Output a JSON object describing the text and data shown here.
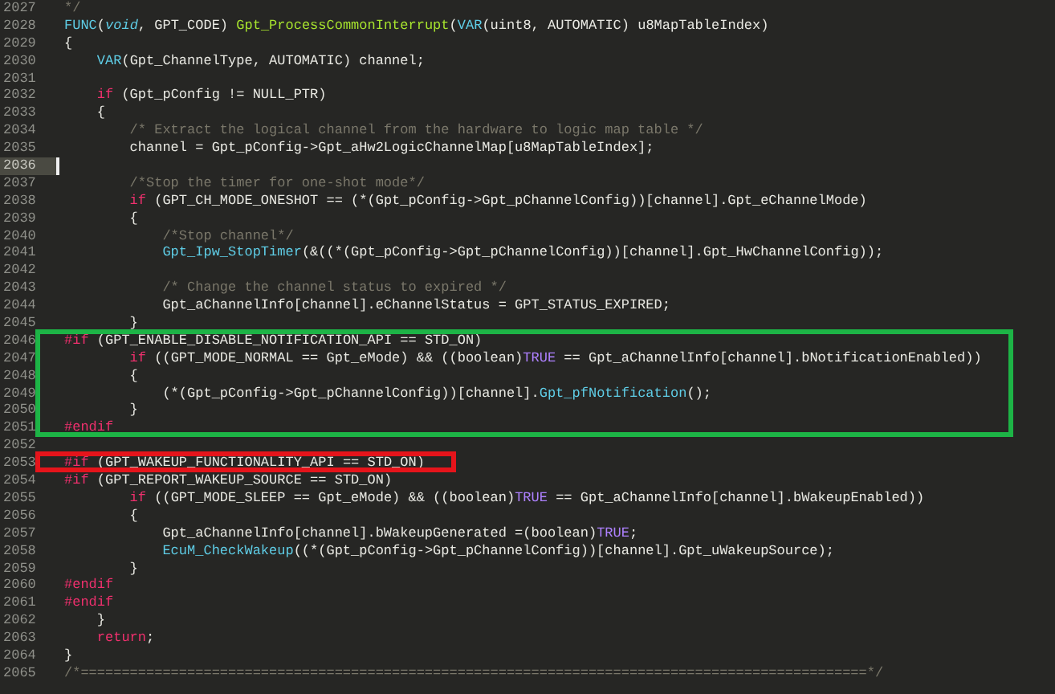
{
  "editor": {
    "lines": [
      {
        "kind": "line",
        "number": "2027",
        "current": false,
        "code": [
          {
            "kind": "comment",
            "text": "*/"
          }
        ]
      },
      {
        "kind": "line",
        "number": "2028",
        "current": false,
        "code": [
          {
            "kind": "macro",
            "text": "FUNC"
          },
          {
            "kind": "text",
            "text": "("
          },
          {
            "kind": "type",
            "text": "void"
          },
          {
            "kind": "text",
            "text": ", GPT_CODE) "
          },
          {
            "kind": "function_def",
            "text": "Gpt_ProcessCommonInterrupt"
          },
          {
            "kind": "text",
            "text": "("
          },
          {
            "kind": "macro",
            "text": "VAR"
          },
          {
            "kind": "text",
            "text": "(uint8, AUTOMATIC) u8MapTableIndex)"
          }
        ]
      },
      {
        "kind": "line",
        "number": "2029",
        "current": false,
        "code": [
          {
            "kind": "text",
            "text": "{"
          }
        ]
      },
      {
        "kind": "line",
        "number": "2030",
        "current": false,
        "code": [
          {
            "kind": "macro",
            "text": "    VAR"
          },
          {
            "kind": "text",
            "text": "(Gpt_ChannelType, AUTOMATIC) channel;"
          }
        ]
      },
      {
        "kind": "line",
        "number": "2031",
        "current": false
      },
      {
        "kind": "line",
        "number": "2032",
        "current": false,
        "code": [
          {
            "kind": "keyword",
            "text": "    if"
          },
          {
            "kind": "text",
            "text": " (Gpt_pConfig != NULL_PTR)"
          }
        ]
      },
      {
        "kind": "line",
        "number": "2033",
        "current": false,
        "code": [
          {
            "kind": "text",
            "text": "    {"
          }
        ]
      },
      {
        "kind": "line",
        "number": "2034",
        "current": false,
        "code": [
          {
            "kind": "comment",
            "text": "        /* Extract the logical channel from the hardware to logic map table */"
          }
        ]
      },
      {
        "kind": "line",
        "number": "2035",
        "current": false,
        "code": [
          {
            "kind": "text",
            "text": "        channel = Gpt_pConfig->Gpt_aHw2LogicChannelMap[u8MapTableIndex];"
          }
        ]
      },
      {
        "kind": "line",
        "number": "2036",
        "current": true
      },
      {
        "kind": "line",
        "number": "2037",
        "current": false,
        "code": [
          {
            "kind": "comment",
            "text": "        /*Stop the timer for one-shot mode*/"
          }
        ]
      },
      {
        "kind": "line",
        "number": "2038",
        "current": false,
        "code": [
          {
            "kind": "keyword",
            "text": "        if"
          },
          {
            "kind": "text",
            "text": " (GPT_CH_MODE_ONESHOT == (*(Gpt_pConfig->Gpt_pChannelConfig))[channel].Gpt_eChannelMode)"
          }
        ]
      },
      {
        "kind": "line",
        "number": "2039",
        "current": false,
        "code": [
          {
            "kind": "text",
            "text": "        {"
          }
        ]
      },
      {
        "kind": "line",
        "number": "2040",
        "current": false,
        "code": [
          {
            "kind": "comment",
            "text": "            /*Stop channel*/"
          }
        ]
      },
      {
        "kind": "line",
        "number": "2041",
        "current": false,
        "code": [
          {
            "kind": "call",
            "text": "            Gpt_Ipw_StopTimer"
          },
          {
            "kind": "text",
            "text": "(&((*(Gpt_pConfig->Gpt_pChannelConfig))[channel].Gpt_HwChannelConfig));"
          }
        ]
      },
      {
        "kind": "line",
        "number": "2042",
        "current": false
      },
      {
        "kind": "line",
        "number": "2043",
        "current": false,
        "code": [
          {
            "kind": "comment",
            "text": "            /* Change the channel status to expired */"
          }
        ]
      },
      {
        "kind": "line",
        "number": "2044",
        "current": false,
        "code": [
          {
            "kind": "text",
            "text": "            Gpt_aChannelInfo[channel].eChannelStatus = GPT_STATUS_EXPIRED;"
          }
        ]
      },
      {
        "kind": "line",
        "number": "2045",
        "current": false,
        "code": [
          {
            "kind": "text",
            "text": "        }"
          }
        ]
      },
      {
        "kind": "box",
        "color": "#1db446",
        "lines": [
          {
            "kind": "line",
            "number": "2046",
            "current": false,
            "code": [
              {
                "kind": "keyword",
                "text": "#if"
              },
              {
                "kind": "text",
                "text": " (GPT_ENABLE_DISABLE_NOTIFICATION_API == STD_ON)"
              }
            ]
          },
          {
            "kind": "line",
            "number": "2047",
            "current": false,
            "code": [
              {
                "kind": "keyword",
                "text": "        if"
              },
              {
                "kind": "text",
                "text": " ((GPT_MODE_NORMAL == Gpt_eMode) && ((boolean)"
              },
              {
                "kind": "constant",
                "text": "TRUE"
              },
              {
                "kind": "text",
                "text": " == Gpt_aChannelInfo[channel].bNotificationEnabled))"
              }
            ]
          },
          {
            "kind": "line",
            "number": "2048",
            "current": false,
            "code": [
              {
                "kind": "text",
                "text": "        {"
              }
            ]
          },
          {
            "kind": "line",
            "number": "2049",
            "current": false,
            "code": [
              {
                "kind": "text",
                "text": "            (*(Gpt_pConfig->Gpt_pChannelConfig))[channel]."
              },
              {
                "kind": "call",
                "text": "Gpt_pfNotification"
              },
              {
                "kind": "text",
                "text": "();"
              }
            ]
          },
          {
            "kind": "line",
            "number": "2050",
            "current": false,
            "code": [
              {
                "kind": "text",
                "text": "        }"
              }
            ]
          },
          {
            "kind": "line",
            "number": "2051",
            "current": false,
            "code": [
              {
                "kind": "keyword",
                "text": "#endif"
              }
            ]
          }
        ]
      },
      {
        "kind": "line",
        "number": "2052",
        "current": false
      },
      {
        "kind": "box",
        "color": "#e5141b",
        "lines": [
          {
            "kind": "line",
            "number": "2053",
            "current": false,
            "code": [
              {
                "kind": "keyword",
                "text": "#if"
              },
              {
                "kind": "text",
                "text": " (GPT_WAKEUP_FUNCTIONALITY_API == STD_ON)"
              }
            ]
          }
        ]
      },
      {
        "kind": "line",
        "number": "2054",
        "current": false,
        "code": [
          {
            "kind": "keyword",
            "text": "#if"
          },
          {
            "kind": "text",
            "text": " (GPT_REPORT_WAKEUP_SOURCE == STD_ON)"
          }
        ]
      },
      {
        "kind": "line",
        "number": "2055",
        "current": false,
        "code": [
          {
            "kind": "keyword",
            "text": "        if"
          },
          {
            "kind": "text",
            "text": " ((GPT_MODE_SLEEP == Gpt_eMode) && ((boolean)"
          },
          {
            "kind": "constant",
            "text": "TRUE"
          },
          {
            "kind": "text",
            "text": " == Gpt_aChannelInfo[channel].bWakeupEnabled))"
          }
        ]
      },
      {
        "kind": "line",
        "number": "2056",
        "current": false,
        "code": [
          {
            "kind": "text",
            "text": "        {"
          }
        ]
      },
      {
        "kind": "line",
        "number": "2057",
        "current": false,
        "code": [
          {
            "kind": "text",
            "text": "            Gpt_aChannelInfo[channel].bWakeupGenerated =(boolean)"
          },
          {
            "kind": "constant",
            "text": "TRUE"
          },
          {
            "kind": "text",
            "text": ";"
          }
        ]
      },
      {
        "kind": "line",
        "number": "2058",
        "current": false,
        "code": [
          {
            "kind": "call",
            "text": "            EcuM_CheckWakeup"
          },
          {
            "kind": "text",
            "text": "((*(Gpt_pConfig->Gpt_pChannelConfig))[channel].Gpt_uWakeupSource);"
          }
        ]
      },
      {
        "kind": "line",
        "number": "2059",
        "current": false,
        "code": [
          {
            "kind": "text",
            "text": "        }"
          }
        ]
      },
      {
        "kind": "line",
        "number": "2060",
        "current": false,
        "code": [
          {
            "kind": "keyword",
            "text": "#endif"
          }
        ]
      },
      {
        "kind": "line",
        "number": "2061",
        "current": false,
        "code": [
          {
            "kind": "keyword",
            "text": "#endif"
          }
        ]
      },
      {
        "kind": "line",
        "number": "2062",
        "current": false,
        "code": [
          {
            "kind": "text",
            "text": "    }"
          }
        ]
      },
      {
        "kind": "line",
        "number": "2063",
        "current": false,
        "code": [
          {
            "kind": "keyword",
            "text": "    return"
          },
          {
            "kind": "text",
            "text": ";"
          }
        ]
      },
      {
        "kind": "line",
        "number": "2064",
        "current": false,
        "code": [
          {
            "kind": "text",
            "text": "}"
          }
        ]
      },
      {
        "kind": "line",
        "number": "2065",
        "current": false,
        "code": [
          {
            "kind": "comment",
            "text": "/*================================================================================================*/"
          }
        ]
      }
    ]
  }
}
